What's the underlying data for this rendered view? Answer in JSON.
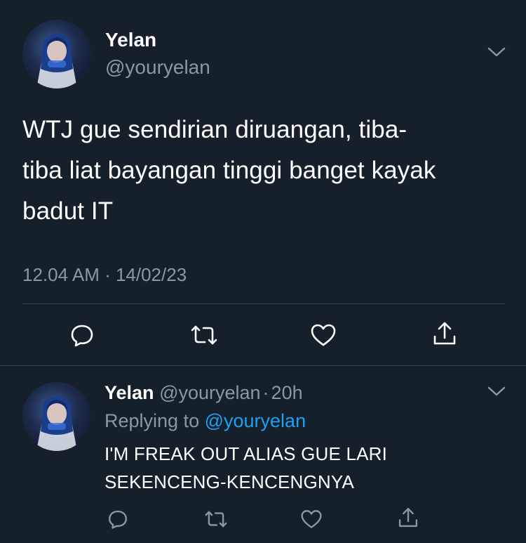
{
  "main_tweet": {
    "avatar_icon": "profile-avatar-icon",
    "display_name": "Yelan",
    "handle": "@youryelan",
    "text_lines": [
      "WTJ gue sendirian diruangan, tiba-",
      "tiba liat bayangan tinggi banget kayak",
      "badut IT"
    ],
    "timestamp": "12.04 AM · 14/02/23",
    "actions": [
      "reply-icon",
      "retweet-icon",
      "like-icon",
      "share-icon"
    ]
  },
  "reply_tweet": {
    "avatar_icon": "profile-avatar-icon",
    "display_name": "Yelan",
    "handle": "@youryelan",
    "dot": "·",
    "age": "20h",
    "replying_prefix": "Replying to",
    "replying_handle": "@youryelan",
    "text_lines": [
      "I'M FREAK OUT ALIAS GUE LARI",
      "SEKENCENG-KENCENGNYA"
    ],
    "actions": [
      "reply-icon",
      "retweet-icon",
      "like-icon",
      "share-icon"
    ]
  },
  "colors": {
    "background": "#15202b",
    "text": "#ffffff",
    "muted": "#8899a6",
    "link": "#1da1f2",
    "divider": "#38444d"
  }
}
